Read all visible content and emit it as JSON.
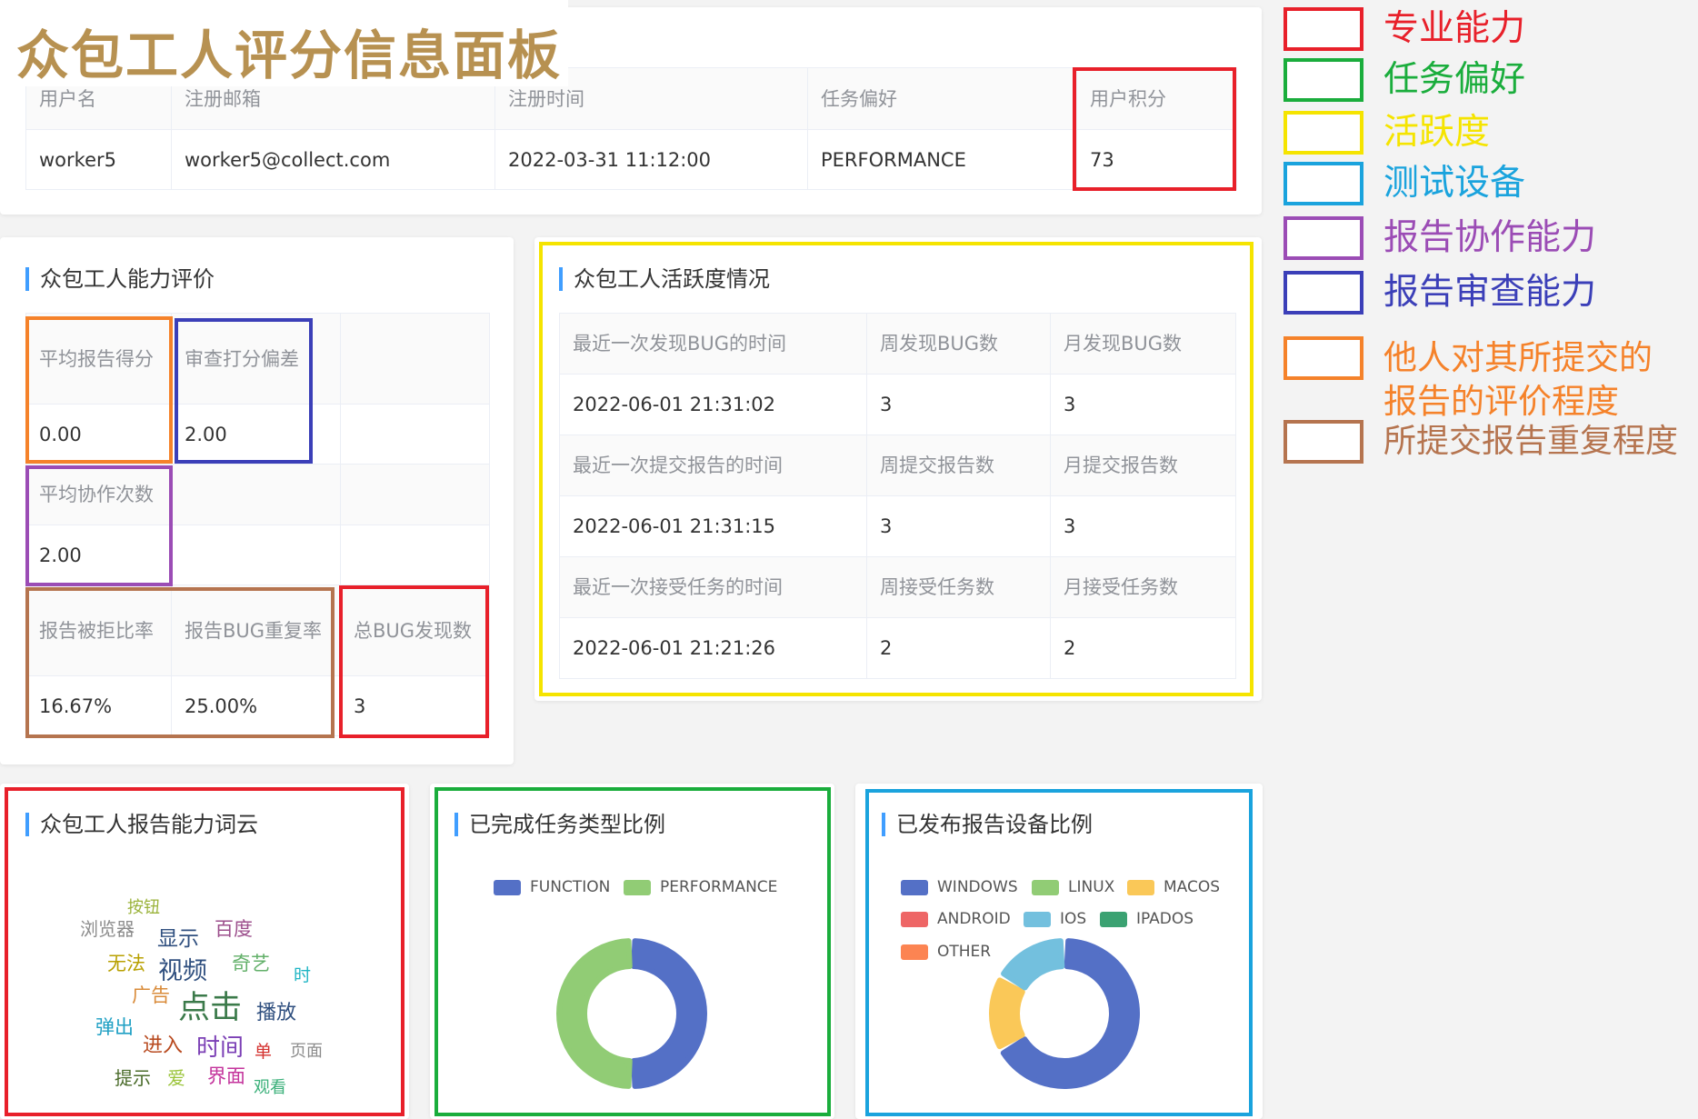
{
  "title": "众包工人评分信息面板",
  "user_table": {
    "headers": [
      "用户名",
      "注册邮箱",
      "注册时间",
      "任务偏好",
      "用户积分"
    ],
    "row": [
      "worker5",
      "worker5@collect.com",
      "2022-03-31 11:12:00",
      "PERFORMANCE",
      "73"
    ]
  },
  "ability": {
    "title": "众包工人能力评价",
    "avg_report_score_label": "平均报告得分",
    "avg_report_score": "0.00",
    "review_bias_label": "审查打分偏差",
    "review_bias": "2.00",
    "avg_collab_label": "平均协作次数",
    "avg_collab": "2.00",
    "reject_rate_label": "报告被拒比率",
    "reject_rate": "16.67%",
    "bug_dup_label": "报告BUG重复率",
    "bug_dup": "25.00%",
    "total_bug_label": "总BUG发现数",
    "total_bug": "3"
  },
  "activity": {
    "title": "众包工人活跃度情况",
    "rows": [
      [
        "最近一次发现BUG的时间",
        "周发现BUG数",
        "月发现BUG数"
      ],
      [
        "2022-06-01 21:31:02",
        "3",
        "3"
      ],
      [
        "最近一次提交报告的时间",
        "周提交报告数",
        "月提交报告数"
      ],
      [
        "2022-06-01 21:31:15",
        "3",
        "3"
      ],
      [
        "最近一次接受任务的时间",
        "周接受任务数",
        "月接受任务数"
      ],
      [
        "2022-06-01 21:21:26",
        "2",
        "2"
      ]
    ]
  },
  "wordcloud": {
    "title": "众包工人报告能力词云",
    "words": [
      {
        "text": "按钮",
        "color": "#9bb33b"
      },
      {
        "text": "浏览器",
        "color": "#8c8c8c"
      },
      {
        "text": "百度",
        "color": "#9c4f8c"
      },
      {
        "text": "显示",
        "color": "#2f4f7f"
      },
      {
        "text": "无法",
        "color": "#b8a000"
      },
      {
        "text": "视频",
        "color": "#2f4f7f"
      },
      {
        "text": "奇艺",
        "color": "#63b06a"
      },
      {
        "text": "时",
        "color": "#1fb5c4"
      },
      {
        "text": "广告",
        "color": "#d98b3a"
      },
      {
        "text": "点击",
        "color": "#3b7a4a"
      },
      {
        "text": "播放",
        "color": "#2f4f7f"
      },
      {
        "text": "弹出",
        "color": "#1fa0c4"
      },
      {
        "text": "进入",
        "color": "#b84a1f"
      },
      {
        "text": "时间",
        "color": "#7b3fb5"
      },
      {
        "text": "单",
        "color": "#d4322f"
      },
      {
        "text": "页面",
        "color": "#8c8c8c"
      },
      {
        "text": "提示",
        "color": "#4a6b2a"
      },
      {
        "text": "爱",
        "color": "#9bc43b"
      },
      {
        "text": "界面",
        "color": "#c4349c"
      },
      {
        "text": "观看",
        "color": "#3bb07a"
      }
    ]
  },
  "task_chart": {
    "title": "已完成任务类型比例",
    "chart_data": {
      "type": "pie",
      "donut": true,
      "legend_position": "top",
      "categories": [
        "FUNCTION",
        "PERFORMANCE"
      ],
      "values": [
        50,
        50
      ],
      "colors": [
        "#5470c6",
        "#91cc75"
      ]
    }
  },
  "device_chart": {
    "title": "已发布报告设备比例",
    "chart_data": {
      "type": "pie",
      "donut": true,
      "legend_position": "top",
      "categories": [
        "WINDOWS",
        "LINUX",
        "MACOS",
        "ANDROID",
        "IOS",
        "IPADOS",
        "OTHER"
      ],
      "values": [
        66.7,
        0,
        16.7,
        0,
        16.6,
        0,
        0
      ],
      "colors": [
        "#5470c6",
        "#91cc75",
        "#fac858",
        "#ee6666",
        "#73c0de",
        "#3ba272",
        "#fc8452"
      ]
    }
  },
  "key": {
    "items": [
      {
        "label": "专业能力",
        "color": "#e8202a"
      },
      {
        "label": "任务偏好",
        "color": "#1aad3c"
      },
      {
        "label": "活跃度",
        "color": "#f5e400"
      },
      {
        "label": "测试设备",
        "color": "#1aa3dd"
      },
      {
        "label": "报告协作能力",
        "color": "#9b4cb5"
      },
      {
        "label": "报告审查能力",
        "color": "#3b3fb8"
      },
      {
        "label": "他人对其所提交的报告的评价程度",
        "color": "#f5822a"
      },
      {
        "label": "所提交报告重复程度",
        "color": "#b5744f"
      }
    ]
  }
}
